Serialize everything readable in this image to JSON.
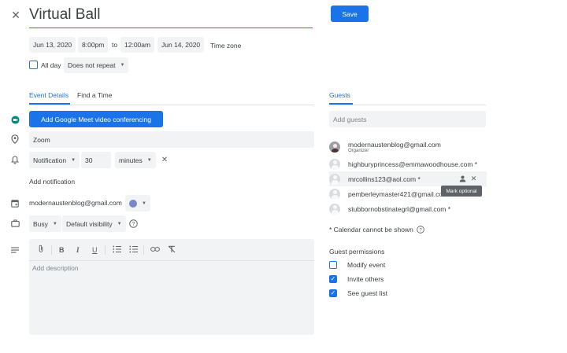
{
  "header": {
    "title": "Virtual Ball",
    "save_label": "Save"
  },
  "datetime": {
    "start_date": "Jun 13, 2020",
    "start_time": "8:00pm",
    "separator": "to",
    "end_time": "12:00am",
    "end_date": "Jun 14, 2020",
    "timezone_label": "Time zone",
    "all_day_label": "All day",
    "repeat_value": "Does not repeat"
  },
  "tabs": [
    {
      "label": "Event Details"
    },
    {
      "label": "Find a Time"
    }
  ],
  "details": {
    "meet_button_label": "Add Google Meet video conferencing",
    "location_value": "Zoom",
    "notification_type": "Notification",
    "notification_amount": "30",
    "notification_unit": "minutes",
    "add_notification_label": "Add notification",
    "calendar_owner": "modernaustenblog@gmail.com",
    "calendar_color": "#7986cb",
    "busy_value": "Busy",
    "visibility_value": "Default visibility",
    "description_placeholder": "Add description"
  },
  "guests": {
    "section_label": "Guests",
    "add_placeholder": "Add guests",
    "list": [
      {
        "email": "modernaustenblog@gmail.com",
        "role": "Organizer"
      },
      {
        "email": "highburyprincess@emmawoodhouse.com *"
      },
      {
        "email": "mrcollins123@aol.com *"
      },
      {
        "email": "pemberleymaster421@gmail.com"
      },
      {
        "email": "stubbornobstinategrl@gmail.com *"
      }
    ],
    "tooltip": "Mark optional",
    "calendar_note": "* Calendar cannot be shown"
  },
  "permissions": {
    "label": "Guest permissions",
    "items": [
      {
        "label": "Modify event",
        "checked": false
      },
      {
        "label": "Invite others",
        "checked": true
      },
      {
        "label": "See guest list",
        "checked": true
      }
    ]
  },
  "colors": {
    "accent": "#1a73e8",
    "field_bg": "#f1f3f4"
  }
}
